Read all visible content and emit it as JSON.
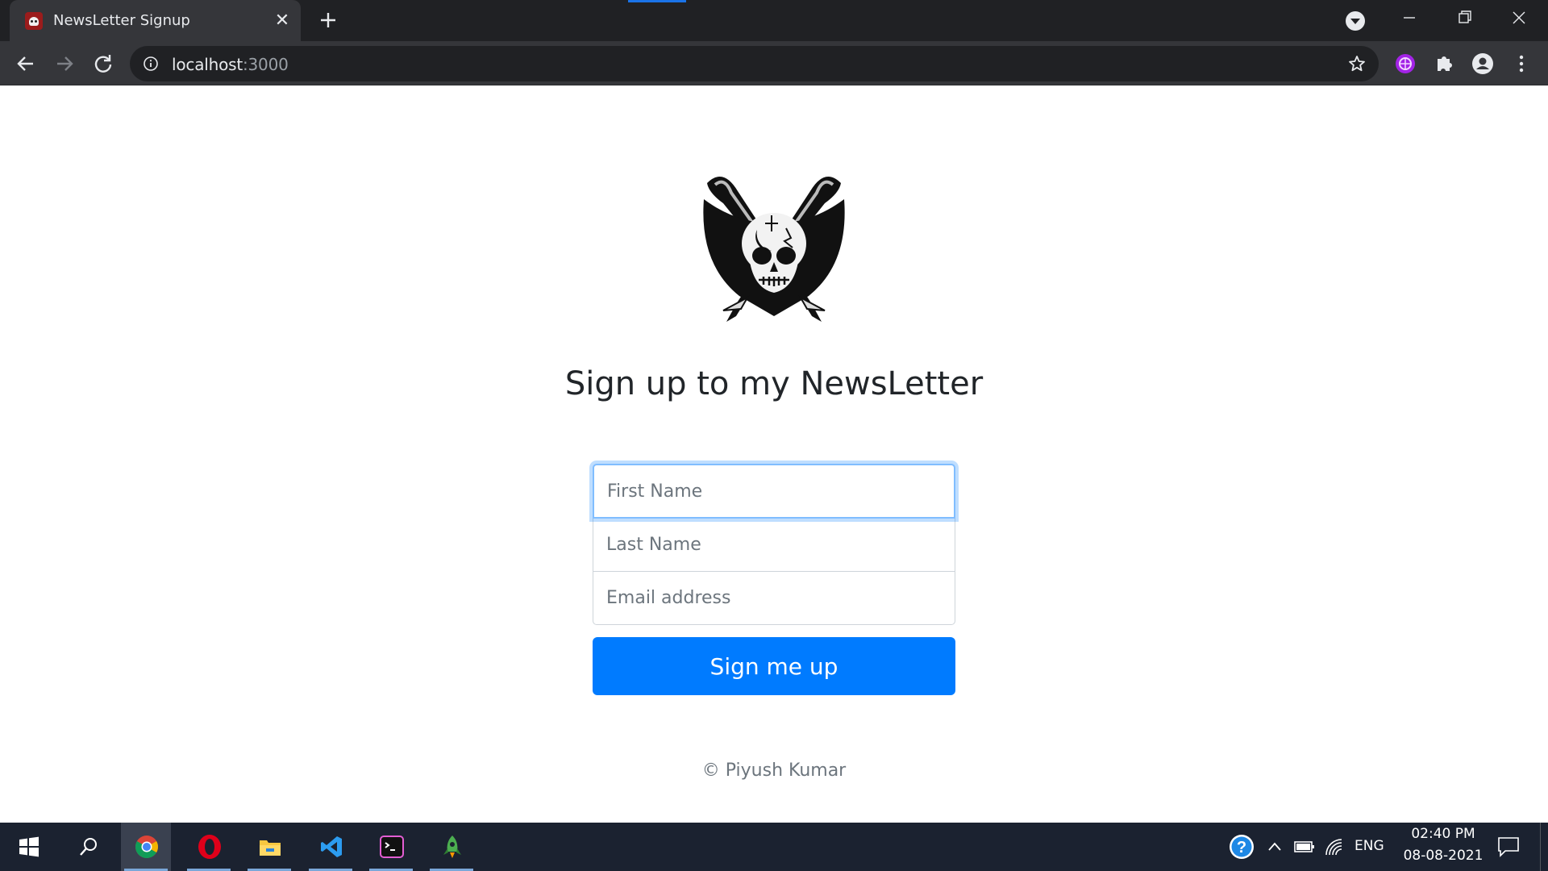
{
  "browser": {
    "tab": {
      "title": "NewsLetter Signup",
      "close_label": "✕"
    },
    "address_bar": {
      "host": "localhost",
      "port": ":3000"
    }
  },
  "page": {
    "logo_icon": "pirate-skull-crossed-swords-icon",
    "headline": "Sign up to my NewsLetter",
    "form": {
      "first_name_placeholder": "First Name",
      "last_name_placeholder": "Last Name",
      "email_placeholder": "Email address",
      "submit_label": "Sign me up"
    },
    "footer": "© Piyush Kumar"
  },
  "taskbar": {
    "apps": [
      "windows-start-icon",
      "search-icon",
      "chrome-icon",
      "opera-icon",
      "file-explorer-icon",
      "vscode-icon",
      "terminal-icon",
      "rocket-app-icon"
    ],
    "language": "ENG",
    "time": "02:40 PM",
    "date": "08-08-2021"
  },
  "colors": {
    "primary_button": "#007bff",
    "focus_border": "#80bdff",
    "browser_dark": "#202124",
    "taskbar": "#1b2230"
  }
}
